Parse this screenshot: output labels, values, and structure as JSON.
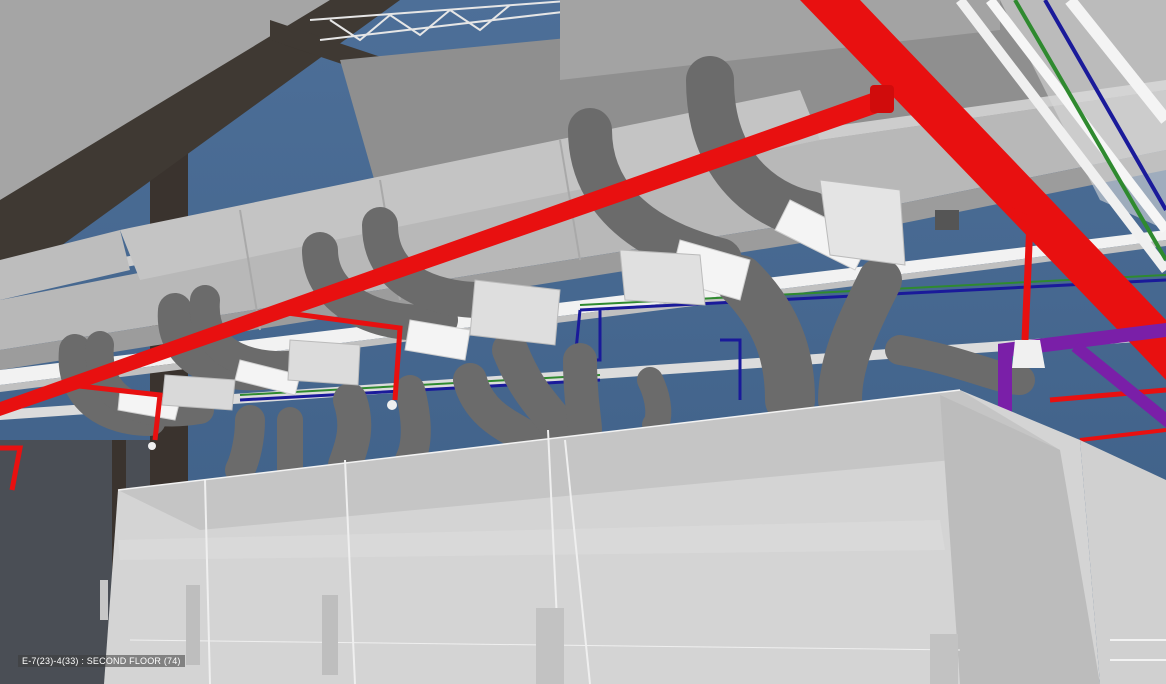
{
  "viewport": {
    "level_label": "E-7(23)-4(33) : SECOND FLOOR (74)"
  },
  "colors": {
    "sprinkler_pipe": "#e81010",
    "purple_pipe": "#7a1fa8",
    "duct": "#c9c9c9",
    "flex_duct": "#6e6e6e",
    "sky": "#3f5f86",
    "green_pipe": "#2f8a2f",
    "blue_pipe": "#1a1a9a"
  }
}
